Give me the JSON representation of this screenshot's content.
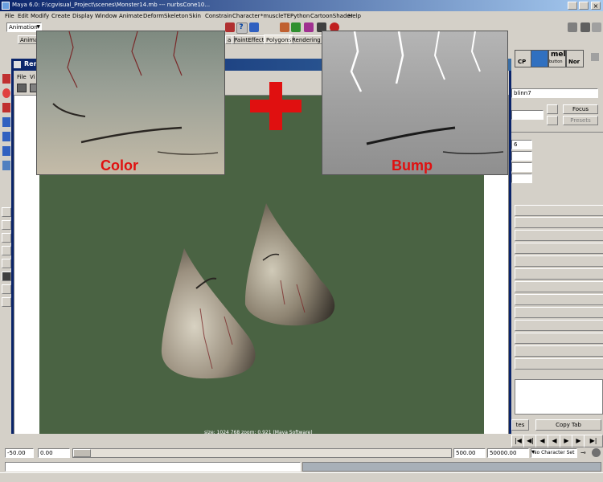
{
  "window": {
    "title": "Maya 6.0: F:\\cgvisual_Project\\scenes\\Monster14.mb  ---  nurbsCone10..."
  },
  "menubar": [
    "File",
    "Edit",
    "Modify",
    "Create",
    "Display",
    "Window",
    "Animate",
    "Deform",
    "Skeleton",
    "Skin",
    "Constrain",
    "Character",
    "*muscleTE",
    "Python",
    "CartoonShader",
    "Help"
  ],
  "mode_dropdown": "Animation",
  "shelf_tabs": [
    "Animati",
    "al",
    "PaintEffects",
    "Polygons",
    "Rendering"
  ],
  "shelf_icons": [
    "CP",
    "mel",
    "button",
    "Nor"
  ],
  "render_view": {
    "title": "Rend",
    "menus": [
      "File",
      "Vi"
    ],
    "info": "size: 1024  768  zoom: 0.921  (Maya Software)"
  },
  "texture_labels": {
    "color": "Color",
    "bump": "Bump"
  },
  "plus_color": "#e01010",
  "label_color": "#e01010",
  "attribute_editor": {
    "node": "blinn7",
    "focus_label": "Focus",
    "presets_label": "Presets",
    "field_value": "6"
  },
  "copy_tab": {
    "left_label": "tes",
    "label": "Copy Tab"
  },
  "time": {
    "start": "-50.00",
    "current": "0.00",
    "end": "500.00",
    "range_end": "50000.00",
    "character_set": "No Character Set"
  }
}
